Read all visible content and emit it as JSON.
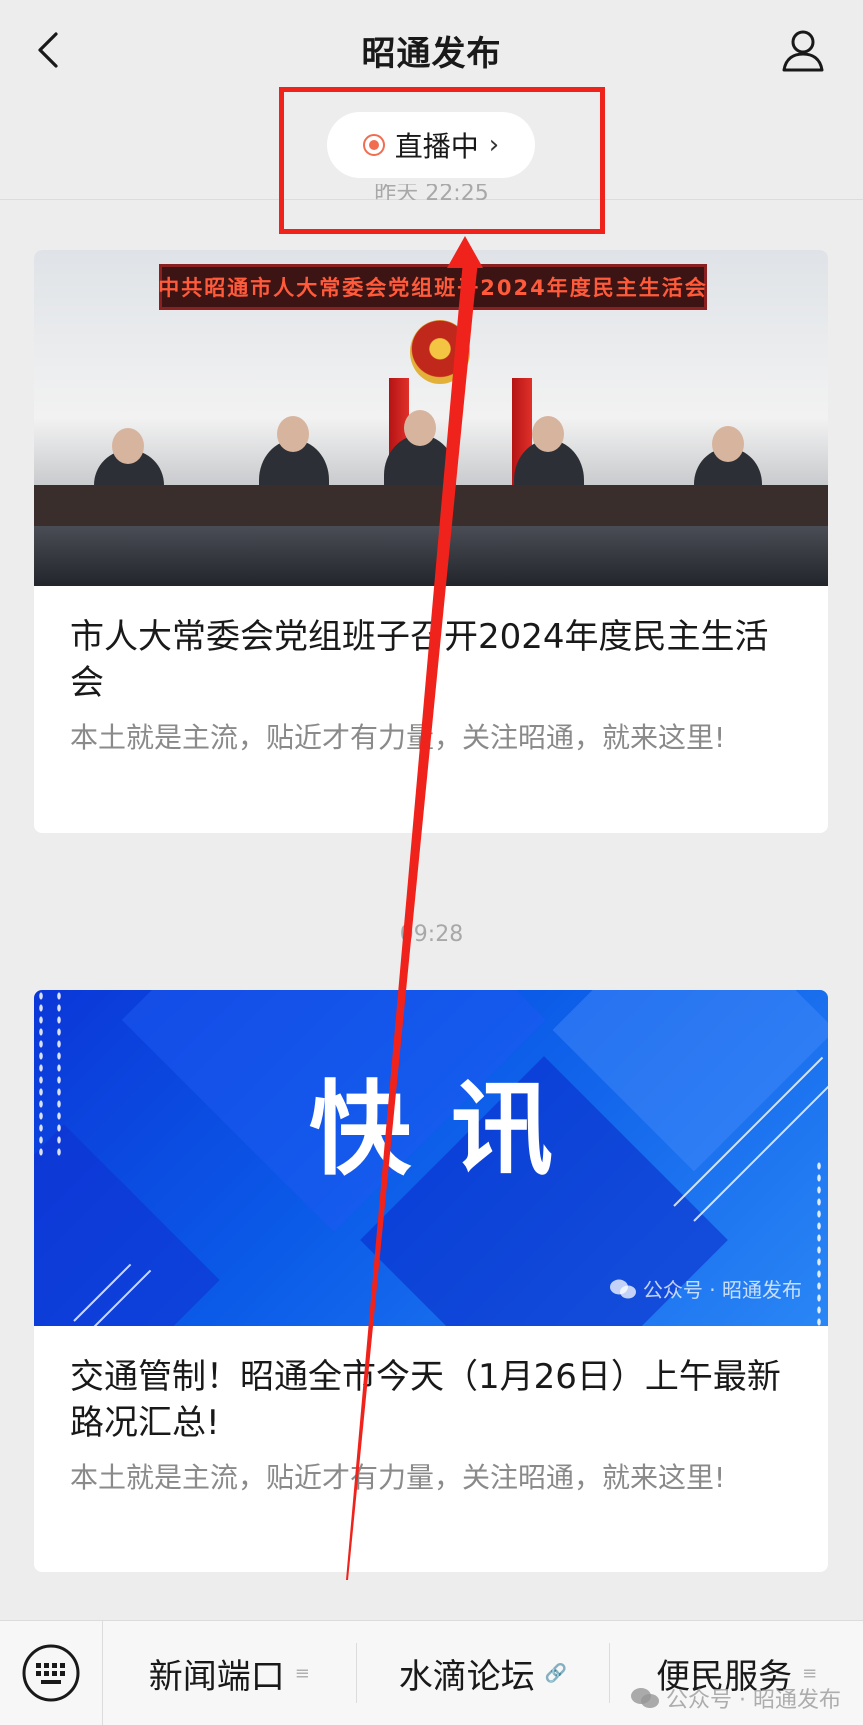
{
  "header": {
    "title": "昭通发布",
    "back_icon": "chevron-left-icon",
    "profile_icon": "person-icon"
  },
  "live": {
    "label": "直播中",
    "chevron": "›",
    "dot_color": "#f26d4f"
  },
  "feed": {
    "timestamp_partial": "昨天 22:25",
    "articles": [
      {
        "cover_banner": "中共昭通市人大常委会党组班子2024年度民主生活会",
        "title": "市人大常委会党组班子召开2024年度民主生活会",
        "desc": "本土就是主流，贴近才有力量，关注昭通，就来这里!"
      },
      {
        "timestamp": "09:28",
        "cover_text": "快讯",
        "cover_watermark": "公众号 · 昭通发布",
        "title": "交通管制！昭通全市今天（1月26日）上午最新路况汇总!",
        "desc": "本土就是主流，贴近才有力量，关注昭通，就来这里!"
      }
    ]
  },
  "menu": {
    "keyboard_icon": "keyboard-icon",
    "items": [
      {
        "label": "新闻端口",
        "icon": "≡"
      },
      {
        "label": "水滴论坛",
        "icon": "🔗"
      },
      {
        "label": "便民服务",
        "icon": "≡"
      }
    ],
    "watermark": "公众号 · 昭通发布"
  },
  "annotation": {
    "color": "#f0231c"
  }
}
